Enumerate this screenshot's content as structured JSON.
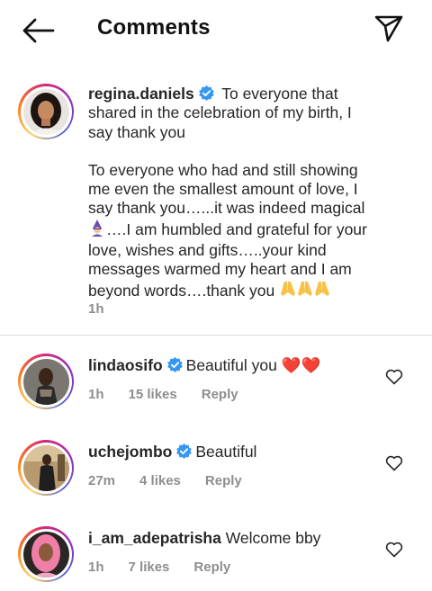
{
  "header": {
    "title": "Comments"
  },
  "caption": {
    "username": "regina.daniels",
    "line1": "To everyone that shared in the celebration of my birth, I say thank you",
    "para2_a": "To everyone who had and still showing me even the smallest amount of love, I say thank you…...it was indeed magical",
    "para2_b": "….I am humbled and grateful for your love, wishes and gifts…..your kind messages warmed my heart and I am beyond words….thank you",
    "time": "1h"
  },
  "comments": [
    {
      "username": "lindaosifo",
      "verified": true,
      "text": "Beautiful you ❤️❤️",
      "time": "1h",
      "likes": "15 likes",
      "reply": "Reply"
    },
    {
      "username": "uchejombo",
      "verified": true,
      "text": "Beautiful",
      "time": "27m",
      "likes": "4 likes",
      "reply": "Reply"
    },
    {
      "username": "i_am_adepatrisha",
      "verified": false,
      "text": "Welcome bby",
      "time": "1h",
      "likes": "7 likes",
      "reply": "Reply"
    }
  ],
  "icons": {
    "back": "arrow-left-icon",
    "share": "paper-plane-icon",
    "like": "heart-outline-icon",
    "verified": "verified-badge-icon"
  },
  "colors": {
    "verified_blue": "#3897f0",
    "meta_gray": "#8e8e8e",
    "divider": "#dbdbdb"
  }
}
